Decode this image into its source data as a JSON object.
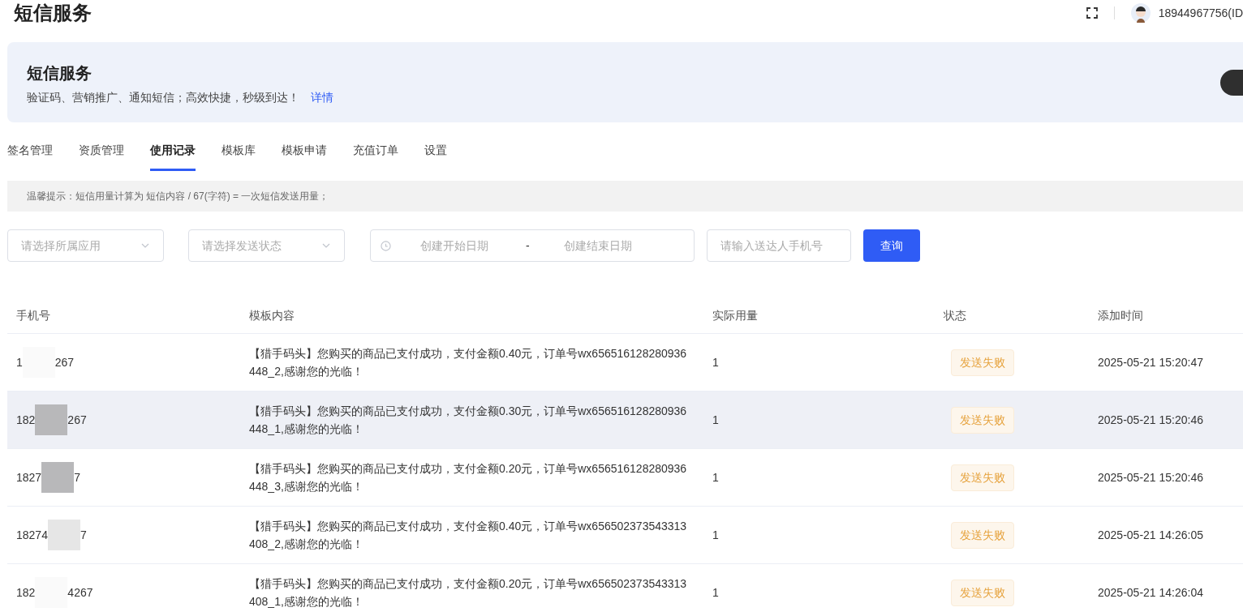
{
  "header": {
    "title": "短信服务",
    "user": "18944967756(ID"
  },
  "banner": {
    "title": "短信服务",
    "description": "验证码、营销推广、通知短信；高效快捷，秒级到达！",
    "link": "详情"
  },
  "tabs": [
    {
      "label": "签名管理",
      "selected": false
    },
    {
      "label": "资质管理",
      "selected": false
    },
    {
      "label": "使用记录",
      "selected": true
    },
    {
      "label": "模板库",
      "selected": false
    },
    {
      "label": "模板申请",
      "selected": false
    },
    {
      "label": "充值订单",
      "selected": false
    },
    {
      "label": "设置",
      "selected": false
    }
  ],
  "tip": "温馨提示：短信用量计算为 短信内容 / 67(字符) = 一次短信发送用量；",
  "filters": {
    "app": {
      "placeholder": "请选择所属应用"
    },
    "status": {
      "placeholder": "请选择发送状态"
    },
    "start_date": {
      "placeholder": "创建开始日期"
    },
    "separator": "-",
    "end_date": {
      "placeholder": "创建结束日期"
    },
    "phone": {
      "placeholder": "请输入送达人手机号"
    },
    "query_button": "查询"
  },
  "table": {
    "columns": [
      "手机号",
      "模板内容",
      "实际用量",
      "状态",
      "添加时间"
    ],
    "rows": [
      {
        "phone_start": "1",
        "phone_end": "267",
        "content": "【猎手码头】您购买的商品已支付成功，支付金额0.40元，订单号wx656516128280936448_2,感谢您的光临！",
        "usage": "1",
        "status": "发送失败",
        "time": "2025-05-21 15:20:47",
        "selected": false
      },
      {
        "phone_start": "182",
        "phone_end": "267",
        "content": "【猎手码头】您购买的商品已支付成功，支付金额0.30元，订单号wx656516128280936448_1,感谢您的光临！",
        "usage": "1",
        "status": "发送失败",
        "time": "2025-05-21 15:20:46",
        "selected": true
      },
      {
        "phone_start": "1827",
        "phone_end": "7",
        "content": "【猎手码头】您购买的商品已支付成功，支付金额0.20元，订单号wx656516128280936448_3,感谢您的光临！",
        "usage": "1",
        "status": "发送失败",
        "time": "2025-05-21 15:20:46",
        "selected": false
      },
      {
        "phone_start": "18274",
        "phone_end": "7",
        "content": "【猎手码头】您购买的商品已支付成功，支付金额0.40元，订单号wx656502373543313408_2,感谢您的光临！",
        "usage": "1",
        "status": "发送失败",
        "time": "2025-05-21 14:26:05",
        "selected": false
      },
      {
        "phone_start": "182",
        "phone_end": "4267",
        "content": "【猎手码头】您购买的商品已支付成功，支付金额0.20元，订单号wx656502373543313408_1,感谢您的光临！",
        "usage": "1",
        "status": "发送失败",
        "time": "2025-05-21 14:26:04",
        "selected": false
      }
    ]
  }
}
